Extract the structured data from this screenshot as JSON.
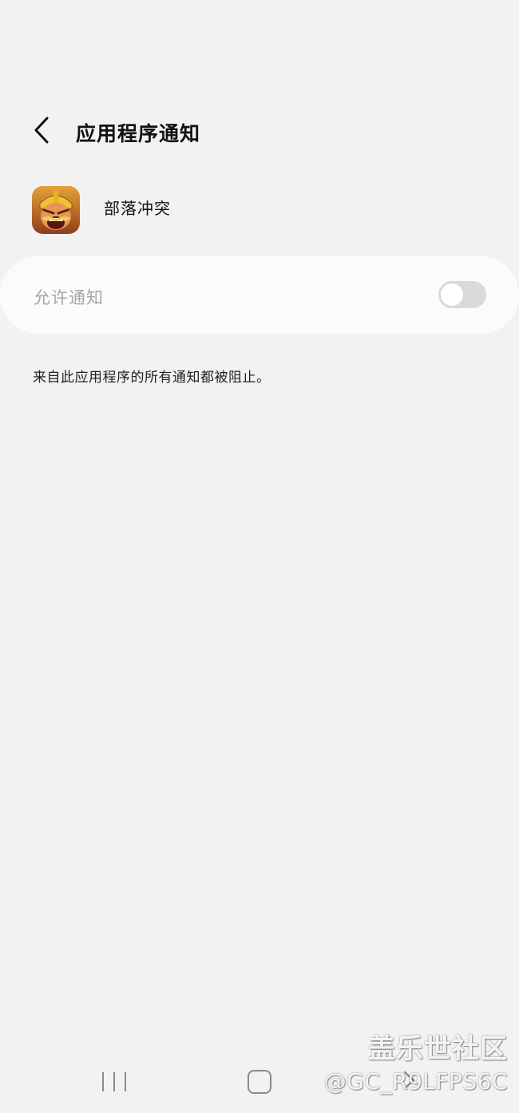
{
  "header": {
    "title": "应用程序通知",
    "back_icon": "chevron-left-icon"
  },
  "app": {
    "name": "部落冲突",
    "icon": "clash-of-clans-app-icon"
  },
  "notifications": {
    "label": "允许通知",
    "enabled": false,
    "description": "来自此应用程序的所有通知都被阻止。"
  },
  "navigation_bar": {
    "recent_icon": "recent-apps-icon",
    "home_icon": "home-icon",
    "back_icon": "back-icon"
  },
  "watermark": {
    "line1": "盖乐世社区",
    "line2": "@GC_R9LFPS6C"
  },
  "colors": {
    "background": "#f2f2f2",
    "card": "#fbfbfb",
    "toggle_off": "#dadada"
  }
}
